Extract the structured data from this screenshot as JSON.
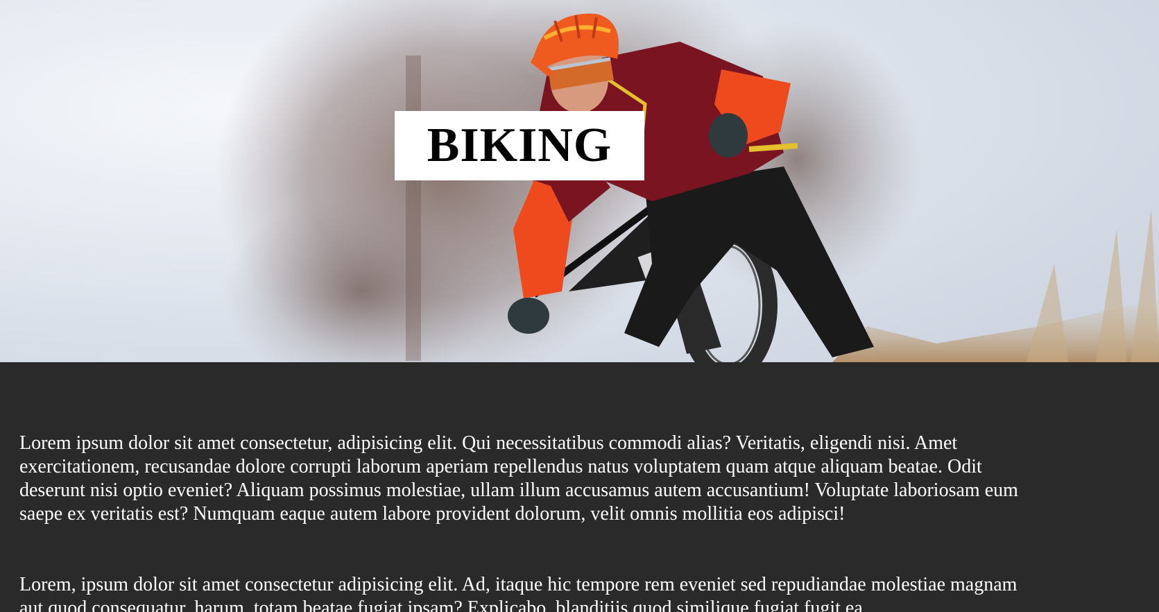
{
  "hero": {
    "title": "BIKING",
    "image": "mountain-biker-photo"
  },
  "content": {
    "paragraphs": [
      "Lorem ipsum dolor sit amet consectetur, adipisicing elit. Qui necessitatibus commodi alias? Veritatis, eligendi nisi. Amet exercitationem, recusandae dolore corrupti laborum aperiam repellendus natus voluptatem quam atque aliquam beatae. Odit deserunt nisi optio eveniet? Aliquam possimus molestiae, ullam illum accusamus autem accusantium! Voluptate laboriosam eum saepe ex veritatis est? Numquam eaque autem labore provident dolorum, velit omnis mollitia eos adipisci!",
      "Lorem, ipsum dolor sit amet consectetur adipisicing elit. Ad, itaque hic tempore rem eveniet sed repudiandae molestiae magnam aut quod consequatur, harum, totam beatae fugiat ipsam? Explicabo, blanditiis quod similique fugiat fugit ea"
    ]
  },
  "colors": {
    "content_background": "#2a2a2a",
    "text": "#ffffff",
    "title_box": "#ffffff",
    "title_text": "#000000"
  }
}
